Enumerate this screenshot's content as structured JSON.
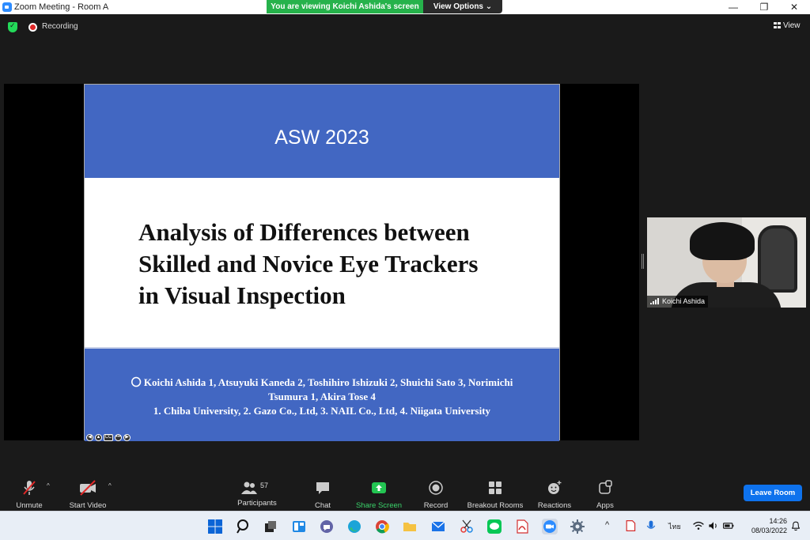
{
  "window": {
    "title": "Zoom Meeting - Room A",
    "minimize": "—",
    "restore": "❐",
    "close": "✕"
  },
  "banner": {
    "viewing_text": "You are viewing Koichi Ashida's screen",
    "view_options": "View Options ⌄"
  },
  "topbar": {
    "recording_label": "Recording",
    "view_label": "View"
  },
  "slide": {
    "conference": "ASW  2023",
    "title_lines": [
      "Analysis of Differences between",
      "Skilled and Novice Eye Trackers",
      "in Visual Inspection"
    ],
    "authors_line1": "〇 Koichi Ashida 1, Atsuyuki Kaneda 2, Toshihiro Ishizuki 2, Shuichi Sato 3, Norimichi",
    "authors_line2": "Tsumura 1, Akira Tose 4",
    "affiliations": "1. Chiba University, 2. Gazo Co., Ltd, 3. NAIL Co., Ltd, 4. Niigata University",
    "controls": [
      "◀",
      "▲",
      "CC",
      "•••",
      "▶"
    ]
  },
  "video": {
    "participant_name": "Koichi Ashida"
  },
  "toolbar": {
    "unmute": "Unmute",
    "start_video": "Start Video",
    "participants": "Participants",
    "participants_count": "57",
    "chat": "Chat",
    "share_screen": "Share Screen",
    "record": "Record",
    "breakout_rooms": "Breakout Rooms",
    "reactions": "Reactions",
    "apps": "Apps",
    "leave_room": "Leave Room",
    "caret": "^"
  },
  "taskbar": {
    "time": "14:26",
    "date": "08/03/2022",
    "ime": "ไทย",
    "tray_caret": "^"
  },
  "colors": {
    "slide_blue": "#4267c2",
    "share_green": "#26b24b",
    "leave_blue": "#0e72ed",
    "muted_red": "#e02828"
  }
}
